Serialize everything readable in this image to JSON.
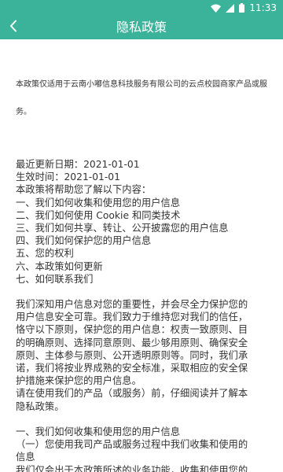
{
  "status": {
    "time": "11:33"
  },
  "header": {
    "title": "隐私政策",
    "back_icon": "chevron-left-icon"
  },
  "colors": {
    "accent": "#3bb39a"
  },
  "intro": {
    "line1": "本政策仅适用于云南小嘟信息科技服务有限公司的云点校园商家产品或服",
    "line2": "务。"
  },
  "meta": {
    "updated": "最近更新日期：2021-01-01",
    "effective": "生效时间：2021-01-01",
    "lead": "本政策将帮助您了解以下内容："
  },
  "toc": [
    "一、我们如何收集和使用您的用户信息",
    "二、我们如何使用 Cookie 和同类技术",
    "三、我们如何共享、转让、公开披露您的用户信息",
    "四、我们如何保护您的用户信息",
    "五、您的权利",
    "六、本政策如何更新",
    "七、如何联系我们"
  ],
  "para1": [
    "我们深知用户信息对您的重要性，并会尽全力保护您的",
    "用户信息安全可靠。我们致力于维持您对我们的信任，",
    "恪守以下原则，保护您的用户信息：权责一致原则、目",
    "的明确原则、选择同意原则、最少够用原则、确保安全",
    "原则、主体参与原则、公开透明原则等。同时，我们承",
    "诺，我们将按业界成熟的安全标准，采取相应的安全保",
    "护措施来保护您的用户信息。"
  ],
  "para2": [
    "请在使用我们的产品（或服务）前，仔细阅读并了解本",
    "隐私政策。"
  ],
  "section1": {
    "heading": "一、我们如何收集和使用您的用户信息",
    "sub": "（一）您使用我司产品或服务过程中我们收集和使用的",
    "sub2": "信息",
    "cut": "我们仅会出于本政策所述的业务功能，收集和使用您的"
  }
}
